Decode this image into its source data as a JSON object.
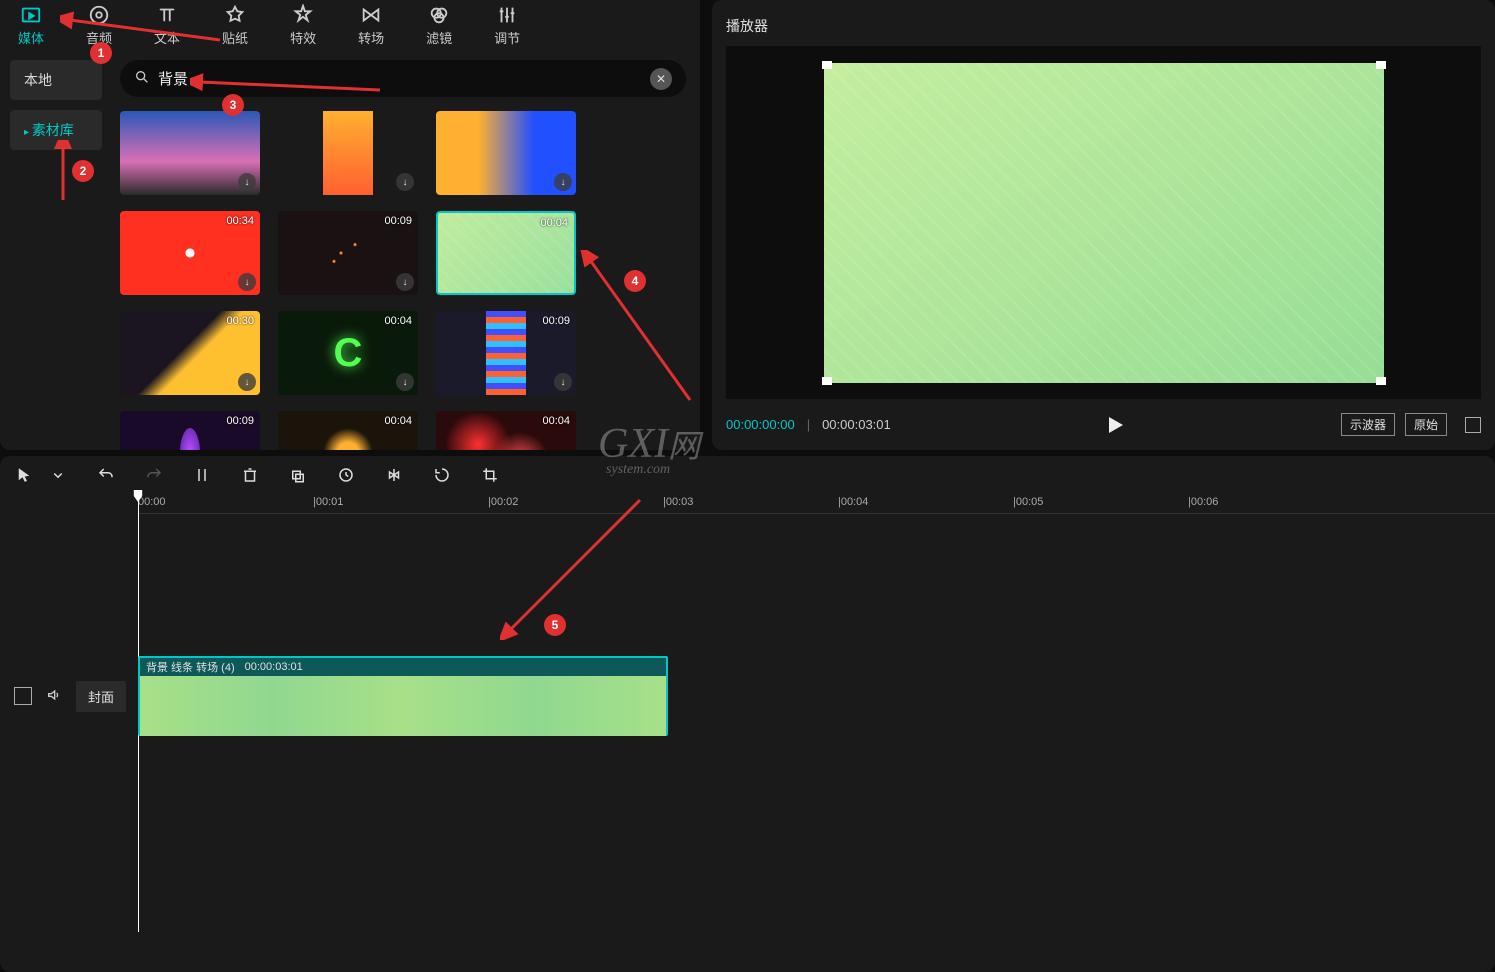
{
  "topTabs": {
    "media": "媒体",
    "audio": "音频",
    "text": "文本",
    "sticker": "贴纸",
    "effects": "特效",
    "transition": "转场",
    "filter": "滤镜",
    "adjust": "调节"
  },
  "sidePanel": {
    "local": "本地",
    "library": "素材库"
  },
  "search": {
    "value": "背景",
    "iconName": "search-icon",
    "clearName": "close-icon"
  },
  "grid": {
    "items": [
      {
        "duration": "",
        "variant": "sky"
      },
      {
        "duration": "",
        "variant": "orange-vert"
      },
      {
        "duration": "",
        "variant": "river"
      },
      {
        "duration": "00:34",
        "variant": "red-burst"
      },
      {
        "duration": "00:09",
        "variant": "particles"
      },
      {
        "duration": "00:04",
        "variant": "green",
        "selected": true
      },
      {
        "duration": "00:30",
        "variant": "gold-diag"
      },
      {
        "duration": "00:04",
        "variant": "energy"
      },
      {
        "duration": "00:09",
        "variant": "stripes"
      },
      {
        "duration": "00:09",
        "variant": "purple"
      },
      {
        "duration": "00:04",
        "variant": "amber"
      },
      {
        "duration": "00:04",
        "variant": "red-swirl"
      }
    ]
  },
  "player": {
    "title": "播放器",
    "currentTime": "00:00:00:00",
    "totalTime": "00:00:03:01",
    "oscilloscope": "示波器",
    "original": "原始"
  },
  "timeline": {
    "ruler": [
      "00:00",
      "|00:01",
      "|00:02",
      "|00:03",
      "|00:04",
      "|00:05",
      "|00:06"
    ],
    "clip": {
      "name": "背景 线条 转场 (4)",
      "duration": "00:00:03:01"
    },
    "coverLabel": "封面"
  },
  "annotations": {
    "n1": "1",
    "n2": "2",
    "n3": "3",
    "n4": "4",
    "n5": "5"
  },
  "watermark": {
    "main": "GXI",
    "suffix": "网",
    "sub": "system.com"
  }
}
